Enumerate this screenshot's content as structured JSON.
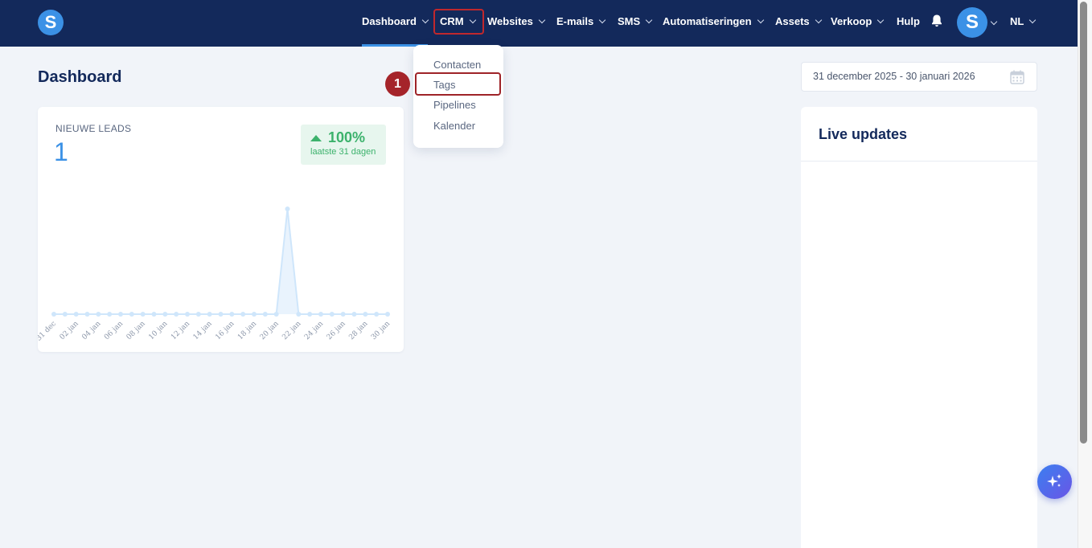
{
  "app": {
    "logo_letter": "S",
    "accent_color": "#3b91e6",
    "nav_background": "#13295b"
  },
  "nav": {
    "items": [
      {
        "label": "Dashboard",
        "has_dropdown": true,
        "active": true
      },
      {
        "label": "CRM",
        "has_dropdown": true,
        "highlighted": true
      },
      {
        "label": "Websites",
        "has_dropdown": true
      },
      {
        "label": "E-mails",
        "has_dropdown": true
      },
      {
        "label": "SMS",
        "has_dropdown": true
      },
      {
        "label": "Automatiseringen",
        "has_dropdown": true
      },
      {
        "label": "Assets",
        "has_dropdown": true
      },
      {
        "label": "Verkoop",
        "has_dropdown": true
      },
      {
        "label": "Hulp",
        "has_dropdown": false
      }
    ],
    "bell_icon": "bell-icon",
    "avatar_letter": "S",
    "language": "NL"
  },
  "crm_menu": {
    "items": [
      {
        "label": "Contacten"
      },
      {
        "label": "Tags",
        "highlighted": true
      },
      {
        "label": "Pipelines"
      },
      {
        "label": "Kalender"
      }
    ],
    "step_number": "1"
  },
  "page": {
    "title": "Dashboard",
    "date_range": "31 december 2025 - 30 januari 2026",
    "calendar_icon": "calendar-icon"
  },
  "leads_card": {
    "label": "NIEUWE LEADS",
    "count": "1",
    "growth_value": "100%",
    "growth_period": "laatste 31 dagen",
    "growth_color": "#3cb26c"
  },
  "chart_data": {
    "type": "area",
    "x": [
      "31 dec",
      "01 jan",
      "02 jan",
      "03 jan",
      "04 jan",
      "05 jan",
      "06 jan",
      "07 jan",
      "08 jan",
      "09 jan",
      "10 jan",
      "11 jan",
      "12 jan",
      "13 jan",
      "14 jan",
      "15 jan",
      "16 jan",
      "17 jan",
      "18 jan",
      "19 jan",
      "20 jan",
      "21 jan",
      "22 jan",
      "23 jan",
      "24 jan",
      "25 jan",
      "26 jan",
      "27 jan",
      "28 jan",
      "29 jan",
      "30 jan"
    ],
    "tick_labels": [
      "31 dec",
      "02 jan",
      "04 jan",
      "06 jan",
      "08 jan",
      "10 jan",
      "12 jan",
      "14 jan",
      "16 jan",
      "18 jan",
      "20 jan",
      "22 jan",
      "24 jan",
      "26 jan",
      "28 jan",
      "30 jan"
    ],
    "values": [
      0,
      0,
      0,
      0,
      0,
      0,
      0,
      0,
      0,
      0,
      0,
      0,
      0,
      0,
      0,
      0,
      0,
      0,
      0,
      0,
      0,
      1,
      0,
      0,
      0,
      0,
      0,
      0,
      0,
      0,
      0
    ],
    "ylim": [
      0,
      1
    ],
    "grid": false,
    "legend": "none",
    "color": "#cfe6fb"
  },
  "live_updates": {
    "title": "Live updates"
  },
  "ai_button": {
    "icon": "sparkle-icon"
  }
}
